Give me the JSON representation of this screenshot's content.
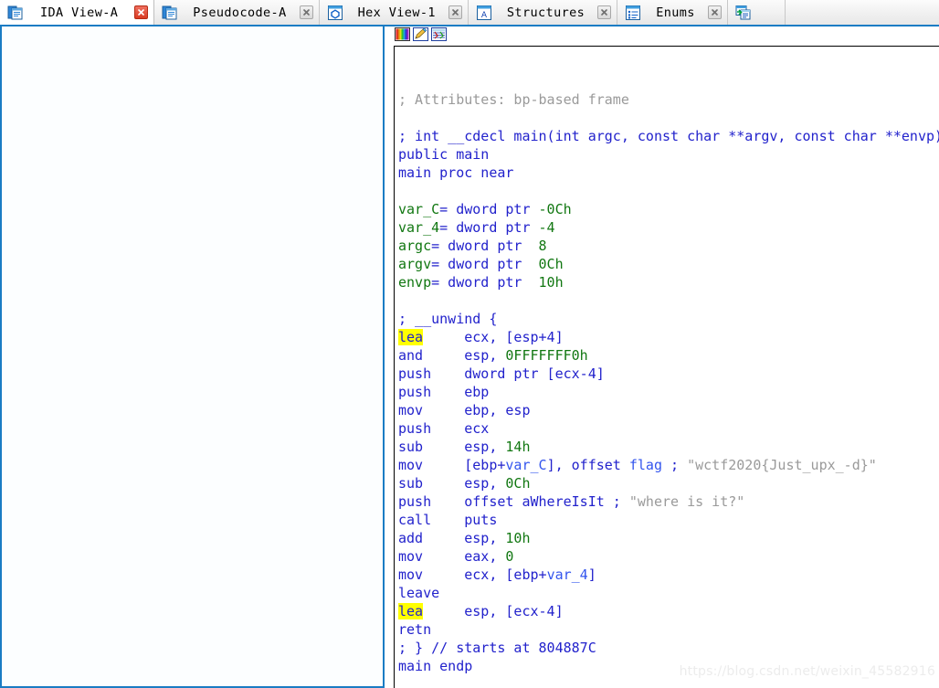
{
  "window": {
    "app": "IDA Pro disassembly window"
  },
  "tabs": [
    {
      "label": "IDA View-A",
      "icon": "document-window-icon",
      "active": true,
      "close_style": "red"
    },
    {
      "label": "Pseudocode-A",
      "icon": "document-window-icon",
      "active": false,
      "close_style": "gray"
    },
    {
      "label": "Hex View-1",
      "icon": "hex-view-icon",
      "active": false,
      "close_style": "gray"
    },
    {
      "label": "Structures",
      "icon": "structures-icon",
      "active": false,
      "close_style": "gray"
    },
    {
      "label": "Enums",
      "icon": "enums-icon",
      "active": false,
      "close_style": "gray"
    },
    {
      "label": "",
      "icon": "imports-icon",
      "active": false,
      "close_style": "none"
    }
  ],
  "toolbar": {
    "icons": [
      {
        "name": "color-palette-icon",
        "title": "Graph overview colors"
      },
      {
        "name": "pencil-edit-icon",
        "title": "Edit"
      },
      {
        "name": "synchronize-icon",
        "title": "Synchronize"
      }
    ]
  },
  "left_pane": {
    "name": "IDA View-A",
    "content": ""
  },
  "code": {
    "lines": [
      {
        "segs": []
      },
      {
        "segs": []
      },
      {
        "segs": [
          {
            "t": "; Attributes: bp-based frame",
            "c": "c-gray"
          }
        ]
      },
      {
        "segs": []
      },
      {
        "segs": [
          {
            "t": "; int __cdecl main(int argc, const char **argv, const char **envp)",
            "c": "c-blue"
          }
        ]
      },
      {
        "segs": [
          {
            "t": "public main",
            "c": "c-blue"
          }
        ]
      },
      {
        "segs": [
          {
            "t": "main proc near",
            "c": "c-blue"
          }
        ]
      },
      {
        "segs": []
      },
      {
        "segs": [
          {
            "t": "var_C",
            "c": "c-green"
          },
          {
            "t": "= dword ptr ",
            "c": "c-blue"
          },
          {
            "t": "-0Ch",
            "c": "c-green"
          }
        ]
      },
      {
        "segs": [
          {
            "t": "var_4",
            "c": "c-green"
          },
          {
            "t": "= dword ptr ",
            "c": "c-blue"
          },
          {
            "t": "-4",
            "c": "c-green"
          }
        ]
      },
      {
        "segs": [
          {
            "t": "argc",
            "c": "c-green"
          },
          {
            "t": "= dword ptr  ",
            "c": "c-blue"
          },
          {
            "t": "8",
            "c": "c-green"
          }
        ]
      },
      {
        "segs": [
          {
            "t": "argv",
            "c": "c-green"
          },
          {
            "t": "= dword ptr  ",
            "c": "c-blue"
          },
          {
            "t": "0Ch",
            "c": "c-green"
          }
        ]
      },
      {
        "segs": [
          {
            "t": "envp",
            "c": "c-green"
          },
          {
            "t": "= dword ptr  ",
            "c": "c-blue"
          },
          {
            "t": "10h",
            "c": "c-green"
          }
        ]
      },
      {
        "segs": []
      },
      {
        "segs": [
          {
            "t": "; __unwind {",
            "c": "c-blue"
          }
        ]
      },
      {
        "segs": [
          {
            "t": "lea",
            "c": "c-blue hl"
          },
          {
            "t": "     ecx, [esp+4]",
            "c": "c-blue"
          }
        ]
      },
      {
        "segs": [
          {
            "t": "and     esp, ",
            "c": "c-blue"
          },
          {
            "t": "0FFFFFFF0h",
            "c": "c-green"
          }
        ]
      },
      {
        "segs": [
          {
            "t": "push    dword ptr [ecx-4]",
            "c": "c-blue"
          }
        ]
      },
      {
        "segs": [
          {
            "t": "push    ebp",
            "c": "c-blue"
          }
        ]
      },
      {
        "segs": [
          {
            "t": "mov     ebp, esp",
            "c": "c-blue"
          }
        ]
      },
      {
        "segs": [
          {
            "t": "push    ecx",
            "c": "c-blue"
          }
        ]
      },
      {
        "segs": [
          {
            "t": "sub     esp, ",
            "c": "c-blue"
          },
          {
            "t": "14h",
            "c": "c-green"
          }
        ]
      },
      {
        "segs": [
          {
            "t": "mov     [ebp+",
            "c": "c-blue"
          },
          {
            "t": "var_C",
            "c": "c-lblue"
          },
          {
            "t": "], offset ",
            "c": "c-blue"
          },
          {
            "t": "flag",
            "c": "c-lblue"
          },
          {
            "t": " ; ",
            "c": "c-blue"
          },
          {
            "t": "\"wctf2020{Just_upx_-d}\"",
            "c": "c-gray"
          }
        ]
      },
      {
        "segs": [
          {
            "t": "sub     esp, ",
            "c": "c-blue"
          },
          {
            "t": "0Ch",
            "c": "c-green"
          }
        ]
      },
      {
        "segs": [
          {
            "t": "push    offset aWhereIsIt ; ",
            "c": "c-blue"
          },
          {
            "t": "\"where is it?\"",
            "c": "c-gray"
          }
        ]
      },
      {
        "segs": [
          {
            "t": "call    puts",
            "c": "c-blue"
          }
        ]
      },
      {
        "segs": [
          {
            "t": "add     esp, ",
            "c": "c-blue"
          },
          {
            "t": "10h",
            "c": "c-green"
          }
        ]
      },
      {
        "segs": [
          {
            "t": "mov     eax, ",
            "c": "c-blue"
          },
          {
            "t": "0",
            "c": "c-green"
          }
        ]
      },
      {
        "segs": [
          {
            "t": "mov     ecx, [ebp+",
            "c": "c-blue"
          },
          {
            "t": "var_4",
            "c": "c-lblue"
          },
          {
            "t": "]",
            "c": "c-blue"
          }
        ]
      },
      {
        "segs": [
          {
            "t": "leave",
            "c": "c-blue"
          }
        ]
      },
      {
        "segs": [
          {
            "t": "lea",
            "c": "c-blue hl"
          },
          {
            "t": "     esp, [ecx-4]",
            "c": "c-blue"
          }
        ]
      },
      {
        "segs": [
          {
            "t": "retn",
            "c": "c-blue"
          }
        ]
      },
      {
        "segs": [
          {
            "t": "; } // starts at ",
            "c": "c-blue"
          },
          {
            "t": "804887C",
            "c": "c-blue"
          }
        ]
      },
      {
        "segs": [
          {
            "t": "main endp",
            "c": "c-blue"
          }
        ]
      }
    ]
  },
  "watermark": {
    "text": "https://blog.csdn.net/weixin_45582916"
  }
}
